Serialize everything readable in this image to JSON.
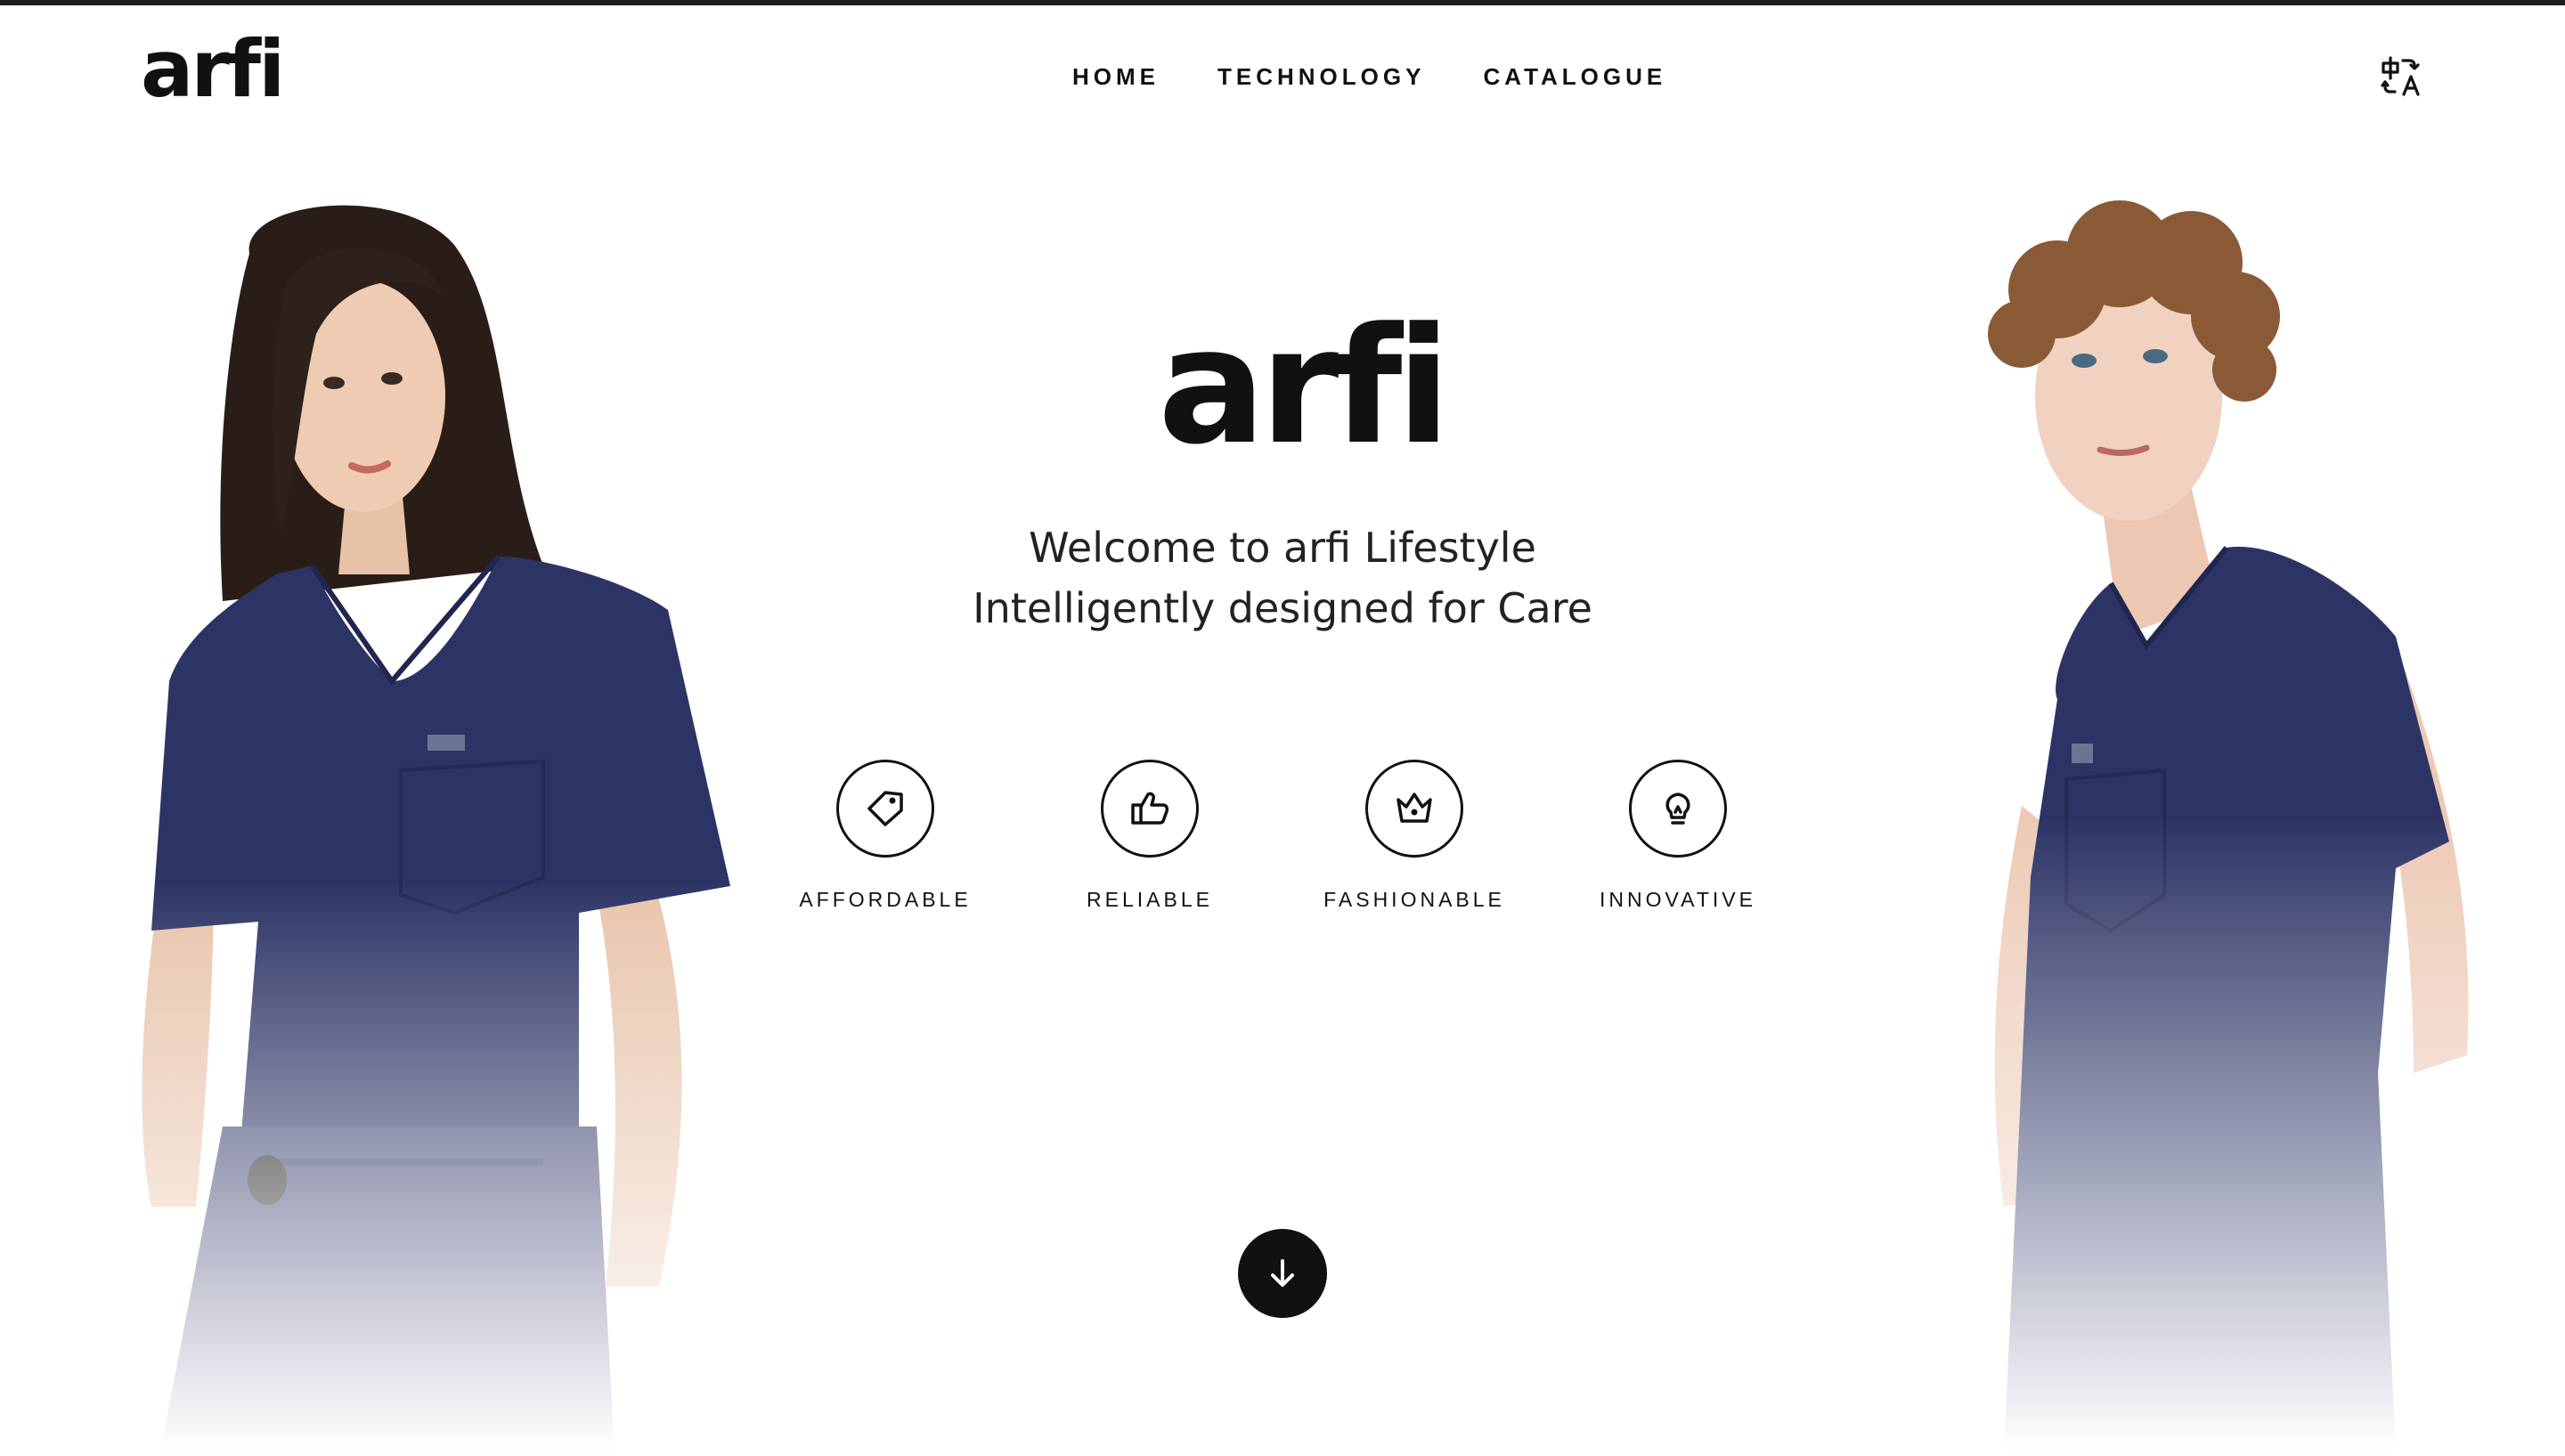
{
  "brand": {
    "name": "arfi"
  },
  "nav": {
    "items": [
      "HOME",
      "TECHNOLOGY",
      "CATALOGUE"
    ]
  },
  "language": {
    "icon": "translate-icon"
  },
  "hero": {
    "logo": "arfi",
    "line1": "Welcome to arfi Lifestyle",
    "line2": "Intelligently designed for Care",
    "features": [
      {
        "label": "AFFORDABLE",
        "icon": "price-tag-icon"
      },
      {
        "label": "RELIABLE",
        "icon": "thumbs-up-icon"
      },
      {
        "label": "FASHIONABLE",
        "icon": "crown-icon"
      },
      {
        "label": "INNOVATIVE",
        "icon": "lightbulb-icon"
      }
    ],
    "scroll_icon": "arrow-down-icon"
  },
  "colors": {
    "scrub": "#2c3465",
    "text": "#111111",
    "background": "#ffffff"
  }
}
